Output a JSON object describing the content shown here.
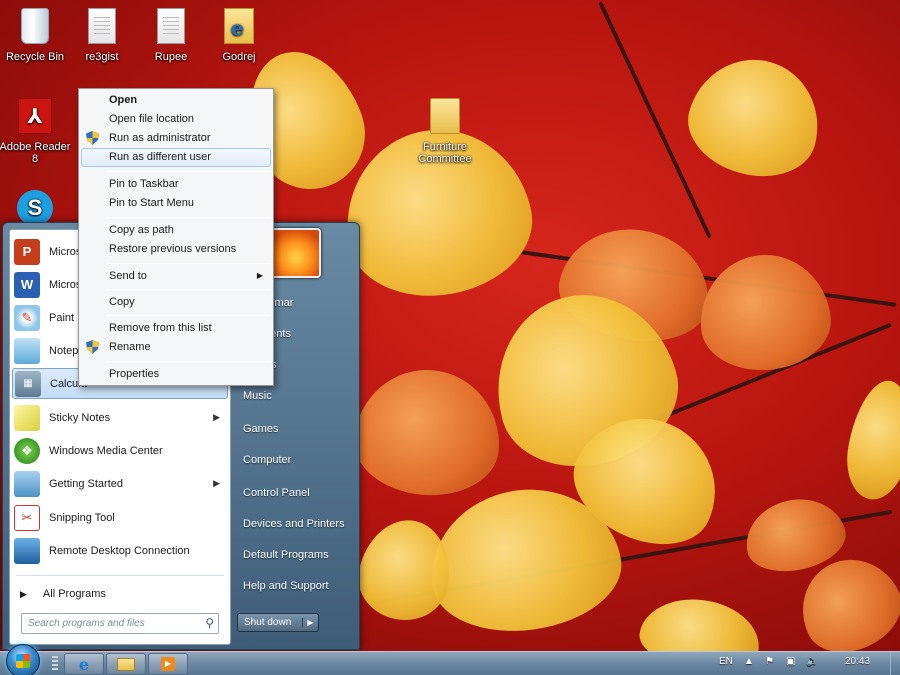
{
  "desktop": {
    "icons": [
      {
        "label": "Recycle Bin",
        "icon": "recycle-bin-icon"
      },
      {
        "label": "re3gist",
        "icon": "document-icon"
      },
      {
        "label": "Rupee",
        "icon": "document-icon"
      },
      {
        "label": "Godrej",
        "icon": "ie-folder-icon"
      },
      {
        "label": "Adobe Reader 8",
        "icon": "adobe-reader-icon"
      },
      {
        "label": "Furniture Committee",
        "icon": "folder-icon"
      },
      {
        "label": "",
        "icon": "skype-icon"
      }
    ]
  },
  "context_menu": {
    "items": {
      "open": "Open",
      "open_file_location": "Open file location",
      "run_as_admin": "Run as administrator",
      "run_as_different_user": "Run as different user",
      "pin_taskbar": "Pin to Taskbar",
      "pin_start": "Pin to Start Menu",
      "copy_as_path": "Copy as path",
      "restore_versions": "Restore previous versions",
      "send_to": "Send to",
      "copy": "Copy",
      "remove_list": "Remove from this list",
      "rename": "Rename",
      "properties": "Properties"
    },
    "highlighted": "Run as different user"
  },
  "start_menu": {
    "programs": [
      {
        "label": "Micros",
        "icon": "powerpoint-icon"
      },
      {
        "label": "Micros",
        "icon": "word-icon"
      },
      {
        "label": "Paint",
        "icon": "paint-icon"
      },
      {
        "label": "Notepa",
        "icon": "notepad-icon"
      },
      {
        "label": "Calcula",
        "icon": "calculator-icon"
      },
      {
        "label": "Sticky Notes",
        "icon": "sticky-notes-icon"
      },
      {
        "label": "Windows Media Center",
        "icon": "media-center-icon"
      },
      {
        "label": "Getting Started",
        "icon": "getting-started-icon"
      },
      {
        "label": "Snipping Tool",
        "icon": "snipping-tool-icon"
      },
      {
        "label": "Remote Desktop Connection",
        "icon": "remote-desktop-icon"
      }
    ],
    "all_programs": "All Programs",
    "search_placeholder": "Search programs and files",
    "right": {
      "user": "Kumar",
      "documents": "ments",
      "pictures": "es",
      "music": "Music",
      "games": "Games",
      "computer": "Computer",
      "control_panel": "Control Panel",
      "devices": "Devices and Printers",
      "default_programs": "Default Programs",
      "help": "Help and Support"
    },
    "shutdown": "Shut down"
  },
  "taskbar": {
    "language": "EN",
    "clock": "20:43",
    "pinned": [
      "internet-explorer-icon",
      "windows-explorer-icon",
      "media-player-icon"
    ]
  },
  "colors": {
    "taskbar": "#6c87a2",
    "start_menu_right": "#4f6e8a",
    "highlight": "#c2dbf6",
    "wallpaper_red": "#b8150f",
    "leaf_yellow": "#f2c23a"
  }
}
